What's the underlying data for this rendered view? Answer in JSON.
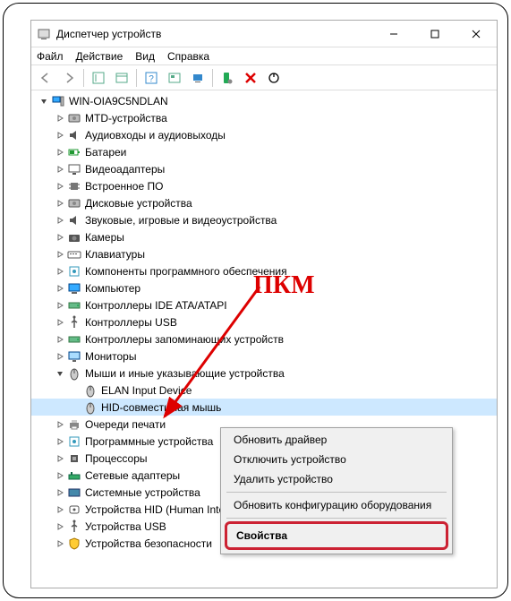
{
  "window": {
    "title": "Диспетчер устройств"
  },
  "menu": {
    "file": "Файл",
    "action": "Действие",
    "view": "Вид",
    "help": "Справка"
  },
  "tree": {
    "root": "WIN-OIA9C5NDLAN",
    "items": [
      {
        "label": "MTD-устройства",
        "icon": "disk"
      },
      {
        "label": "Аудиовходы и аудиовыходы",
        "icon": "audio"
      },
      {
        "label": "Батареи",
        "icon": "battery"
      },
      {
        "label": "Видеоадаптеры",
        "icon": "display"
      },
      {
        "label": "Встроенное ПО",
        "icon": "chip"
      },
      {
        "label": "Дисковые устройства",
        "icon": "disk"
      },
      {
        "label": "Звуковые, игровые и видеоустройства",
        "icon": "audio"
      },
      {
        "label": "Камеры",
        "icon": "camera"
      },
      {
        "label": "Клавиатуры",
        "icon": "keyboard"
      },
      {
        "label": "Компоненты программного обеспечения",
        "icon": "soft",
        "cut": true
      },
      {
        "label": "Компьютер",
        "icon": "computer"
      },
      {
        "label": "Контроллеры IDE ATA/ATAPI",
        "icon": "storage"
      },
      {
        "label": "Контроллеры USB",
        "icon": "usb"
      },
      {
        "label": "Контроллеры запоминающих устройств",
        "icon": "storage",
        "cut": true
      },
      {
        "label": "Мониторы",
        "icon": "monitor"
      },
      {
        "label": "Мыши и иные указывающие устройства",
        "icon": "mouse",
        "expanded": true,
        "children": [
          {
            "label": "ELAN Input Device",
            "icon": "mouse",
            "cut": true
          },
          {
            "label": "HID-совместимая мышь",
            "icon": "mouse",
            "selected": true,
            "cut": true
          }
        ]
      },
      {
        "label": "Очереди печати",
        "icon": "printer"
      },
      {
        "label": "Программные устройства",
        "icon": "soft"
      },
      {
        "label": "Процессоры",
        "icon": "cpu"
      },
      {
        "label": "Сетевые адаптеры",
        "icon": "net"
      },
      {
        "label": "Системные устройства",
        "icon": "system"
      },
      {
        "label": "Устройства HID (Human Interface Devices)",
        "icon": "hid",
        "cut": true
      },
      {
        "label": "Устройства USB",
        "icon": "usb"
      },
      {
        "label": "Устройства безопасности",
        "icon": "security"
      }
    ]
  },
  "context_menu": {
    "update": "Обновить драйвер",
    "disable": "Отключить устройство",
    "uninstall": "Удалить устройство",
    "scan": "Обновить конфигурацию оборудования",
    "properties": "Свойства"
  },
  "annotation": {
    "label": "ПКМ"
  }
}
